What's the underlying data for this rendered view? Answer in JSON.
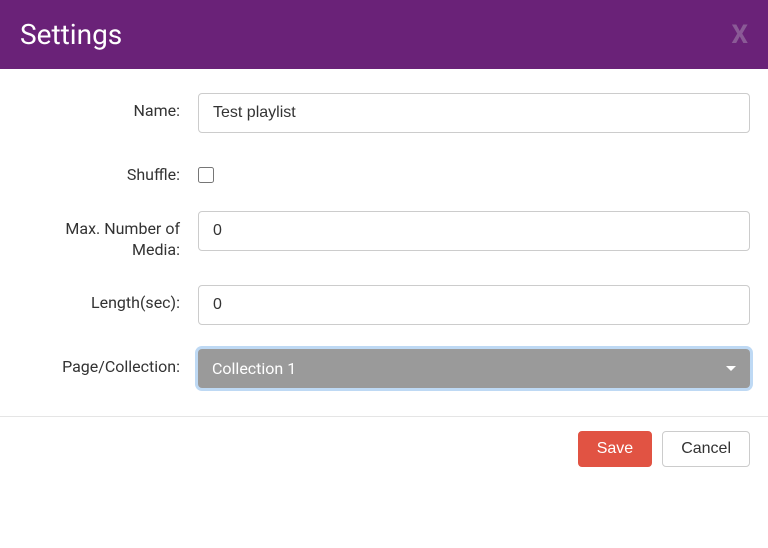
{
  "header": {
    "title": "Settings",
    "close_glyph": "X"
  },
  "form": {
    "name": {
      "label": "Name:",
      "value": "Test playlist"
    },
    "shuffle": {
      "label": "Shuffle:",
      "checked": false
    },
    "max_media": {
      "label": "Max. Number of Media:",
      "value": "0"
    },
    "length": {
      "label": "Length(sec):",
      "value": "0"
    },
    "page_collection": {
      "label": "Page/Collection:",
      "selected": "Collection 1"
    }
  },
  "footer": {
    "save_label": "Save",
    "cancel_label": "Cancel"
  }
}
